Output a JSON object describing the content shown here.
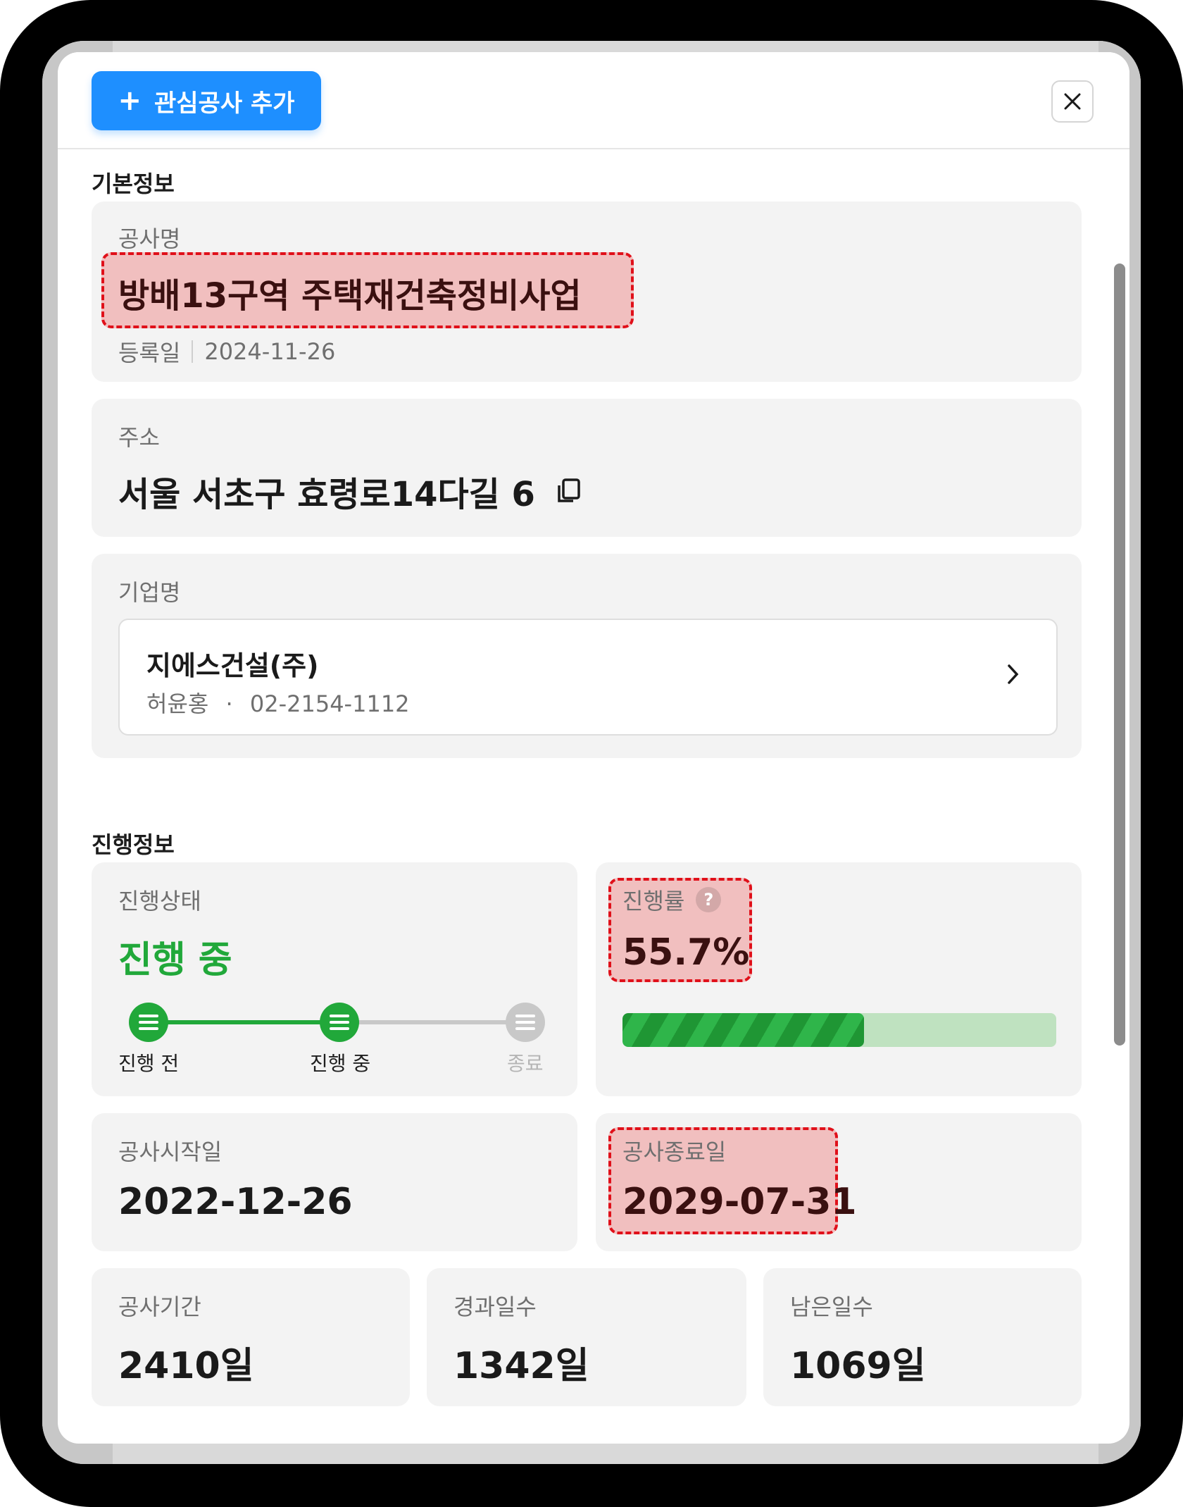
{
  "header": {
    "add_button_label": "관심공사 추가",
    "add_button_icon": "plus-icon",
    "close_icon": "close-icon"
  },
  "basic_info": {
    "section_title": "기본정보",
    "project_name_label": "공사명",
    "project_name": "방배13구역 주택재건축정비사업",
    "registered_label": "등록일",
    "registered_date": "2024-11-26",
    "address_label": "주소",
    "address": "서울 서초구 효령로14다길 6",
    "copy_icon": "copy-icon",
    "company_label": "기업명",
    "company_name": "지에스건설(주)",
    "company_contact_name": "허윤홍",
    "company_separator": "·",
    "company_phone": "02-2154-1112",
    "company_chevron_icon": "chevron-right-icon"
  },
  "progress_info": {
    "section_title": "진행정보",
    "status_label": "진행상태",
    "status_value": "진행 중",
    "status_color": "#21a83a",
    "steps": [
      {
        "label": "진행 전",
        "active": true
      },
      {
        "label": "진행 중",
        "active": true
      },
      {
        "label": "종료",
        "active": false
      }
    ],
    "rate_label": "진행률",
    "rate_help_icon": "question-icon",
    "rate_value": "55.7%",
    "rate_fraction": 0.557,
    "start_label": "공사시작일",
    "start_date": "2022-12-26",
    "end_label": "공사종료일",
    "end_date": "2029-07-31",
    "duration_label": "공사기간",
    "duration_value": "2410일",
    "elapsed_label": "경과일수",
    "elapsed_value": "1342일",
    "remaining_label": "남은일수",
    "remaining_value": "1069일"
  },
  "colors": {
    "accent_blue": "#1e8fff",
    "progress_green": "#21a83a",
    "highlight_red": "#e0101a"
  }
}
